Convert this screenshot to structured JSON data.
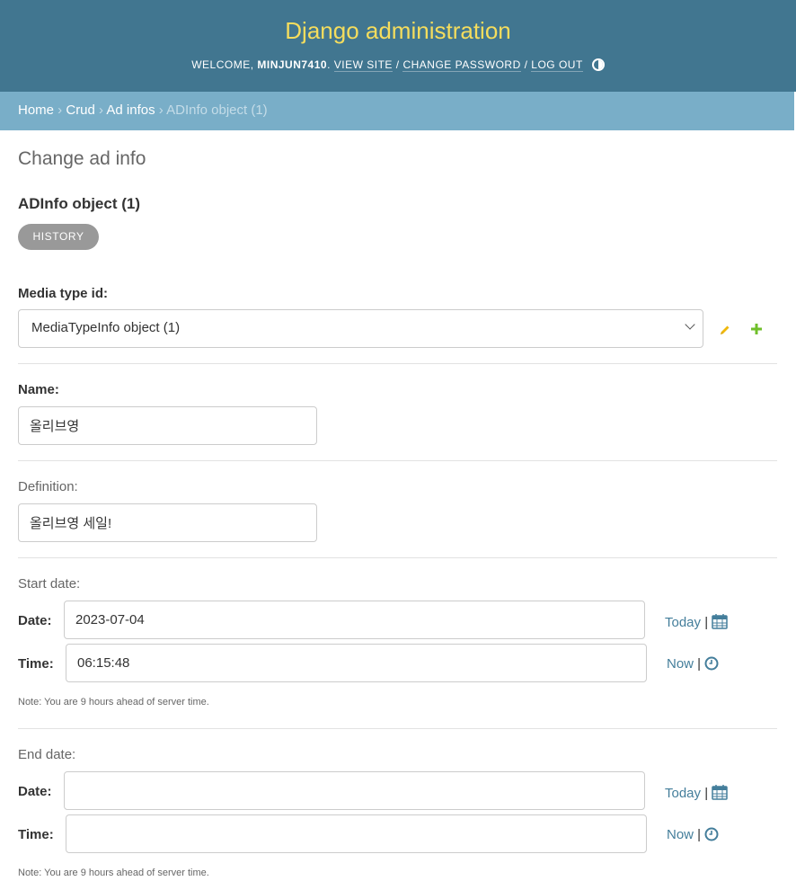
{
  "header": {
    "site_name": "Django administration",
    "welcome": "WELCOME, ",
    "username": "MINJUN7410",
    "period": ". ",
    "view_site": "VIEW SITE",
    "sep1": " / ",
    "change_password": "CHANGE PASSWORD",
    "sep2": " / ",
    "log_out": "LOG OUT"
  },
  "breadcrumbs": {
    "home": "Home",
    "crud": "Crud",
    "ad_infos": "Ad infos",
    "current": "ADInfo object (1)",
    "separator": " › "
  },
  "page": {
    "title": "Change ad info",
    "object_name": "ADInfo object (1)",
    "history_label": "HISTORY"
  },
  "form": {
    "media_type": {
      "label": "Media type id:",
      "value": "MediaTypeInfo object (1)"
    },
    "name": {
      "label": "Name:",
      "value": "올리브영"
    },
    "definition": {
      "label": "Definition:",
      "value": "올리브영 세일!"
    },
    "start_date": {
      "label": "Start date:",
      "date_label": "Date:",
      "date_value": "2023-07-04",
      "time_label": "Time:",
      "time_value": "06:15:48",
      "today_link": "Today",
      "now_link": "Now",
      "note": "Note: You are 9 hours ahead of server time."
    },
    "end_date": {
      "label": "End date:",
      "date_label": "Date:",
      "date_value": "",
      "time_label": "Time:",
      "time_value": "",
      "today_link": "Today",
      "now_link": "Now",
      "note": "Note: You are 9 hours ahead of server time."
    }
  },
  "icons": {
    "edit": "pencil-icon",
    "add": "plus-icon",
    "calendar": "calendar-icon",
    "clock": "clock-icon",
    "theme": "theme-toggle-icon"
  },
  "colors": {
    "header_bg": "#417690",
    "site_name": "#f5dd5d",
    "breadcrumbs_bg": "#79aec8",
    "link": "#447e9b"
  }
}
